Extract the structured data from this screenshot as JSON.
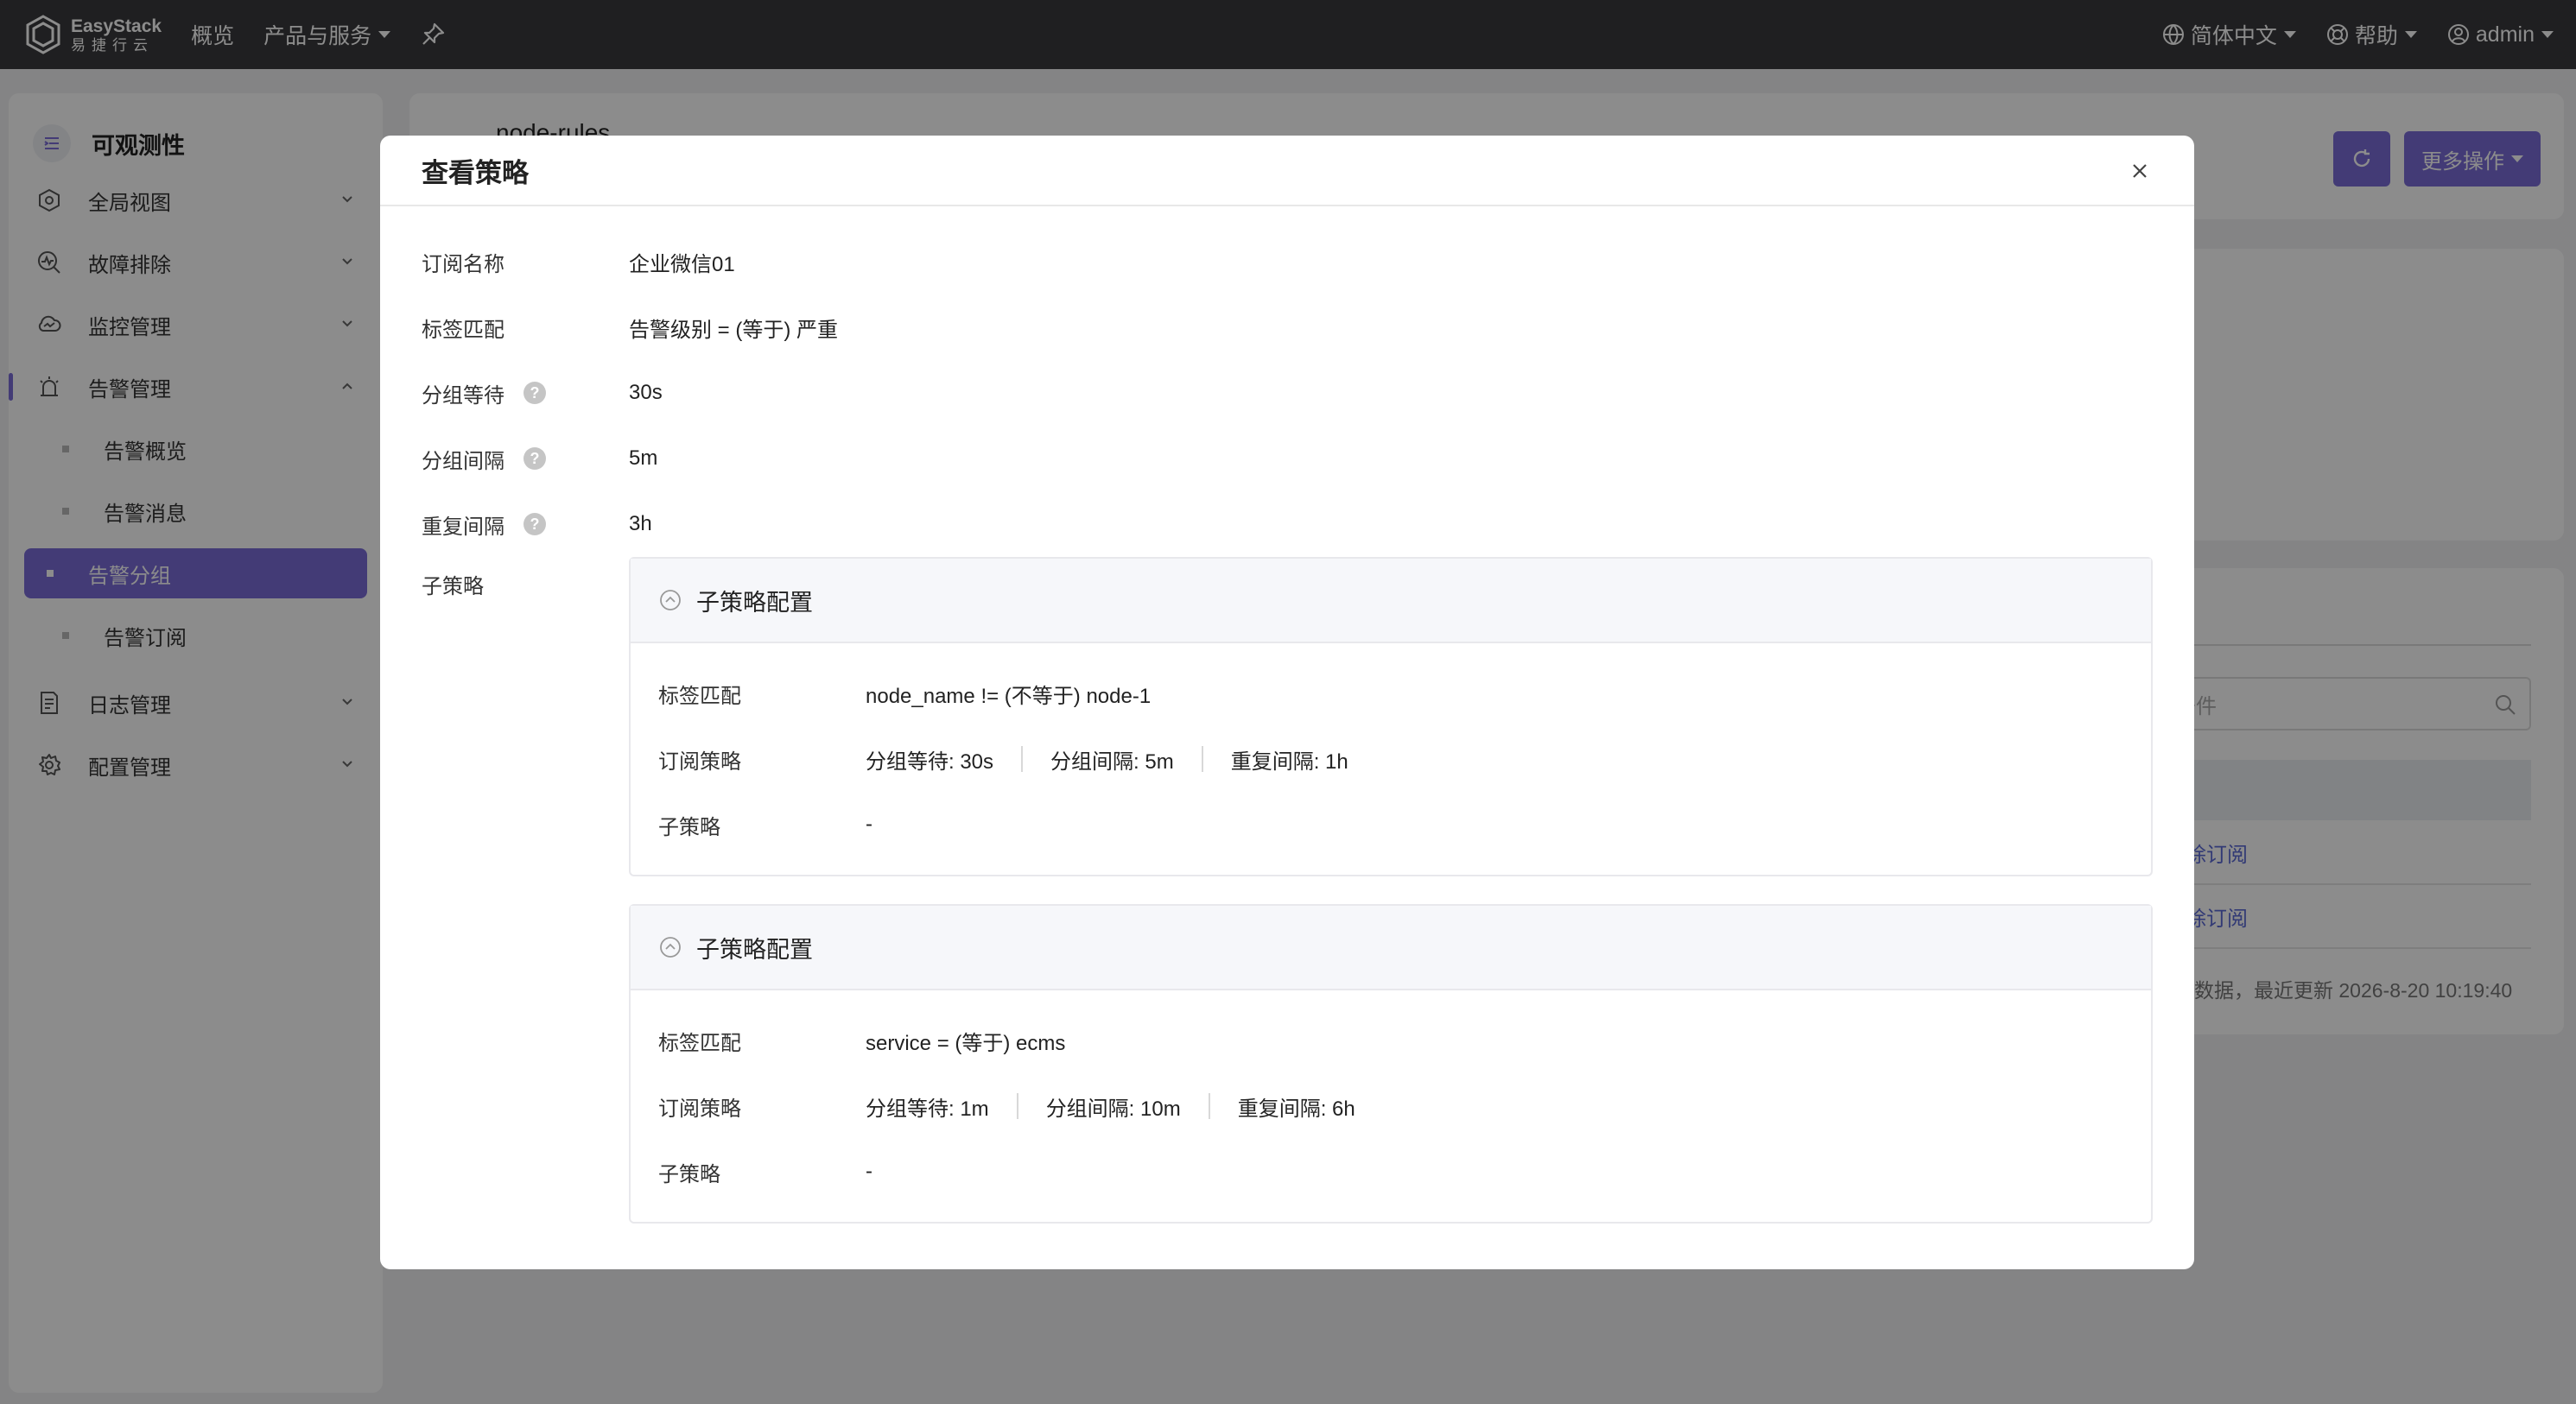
{
  "topbar": {
    "logo_en": "EasyStack",
    "logo_cn": "易捷行云",
    "nav_overview": "概览",
    "nav_products": "产品与服务",
    "lang": "简体中文",
    "help": "帮助",
    "user": "admin"
  },
  "sidebar": {
    "title": "可观测性",
    "items": [
      {
        "label": "全局视图"
      },
      {
        "label": "故障排除"
      },
      {
        "label": "监控管理"
      },
      {
        "label": "告警管理"
      },
      {
        "label": "日志管理"
      },
      {
        "label": "配置管理"
      }
    ],
    "sub_items": [
      {
        "label": "告警概览"
      },
      {
        "label": "告警消息"
      },
      {
        "label": "告警分组"
      },
      {
        "label": "告警订阅"
      }
    ]
  },
  "background": {
    "page_title": "node-rules",
    "more_actions": "更多操作",
    "search_placeholder": "条件",
    "link1": "除订阅",
    "link2": "除订阅",
    "footer": "数据，最近更新   2026-8-20 10:19:40"
  },
  "modal": {
    "title": "查看策略",
    "fields": {
      "name_label": "订阅名称",
      "name_value": "企业微信01",
      "match_label": "标签匹配",
      "match_value": "告警级别 = (等于) 严重",
      "wait_label": "分组等待",
      "wait_value": "30s",
      "interval_label": "分组间隔",
      "interval_value": "5m",
      "repeat_label": "重复间隔",
      "repeat_value": "3h",
      "sub_label": "子策略"
    },
    "help_glyph": "?",
    "panels": [
      {
        "title": "子策略配置",
        "match_label": "标签匹配",
        "match_value": "node_name != (不等于) node-1",
        "policy_label": "订阅策略",
        "wait": "分组等待: 30s",
        "interval": "分组间隔: 5m",
        "repeat": "重复间隔: 1h",
        "sub_label": "子策略",
        "sub_value": "-"
      },
      {
        "title": "子策略配置",
        "match_label": "标签匹配",
        "match_value": "service = (等于) ecms",
        "policy_label": "订阅策略",
        "wait": "分组等待: 1m",
        "interval": "分组间隔: 10m",
        "repeat": "重复间隔: 6h",
        "sub_label": "子策略",
        "sub_value": "-"
      }
    ]
  },
  "colors": {
    "accent": "#7a6cd8",
    "topbar": "#3a3a3c"
  }
}
